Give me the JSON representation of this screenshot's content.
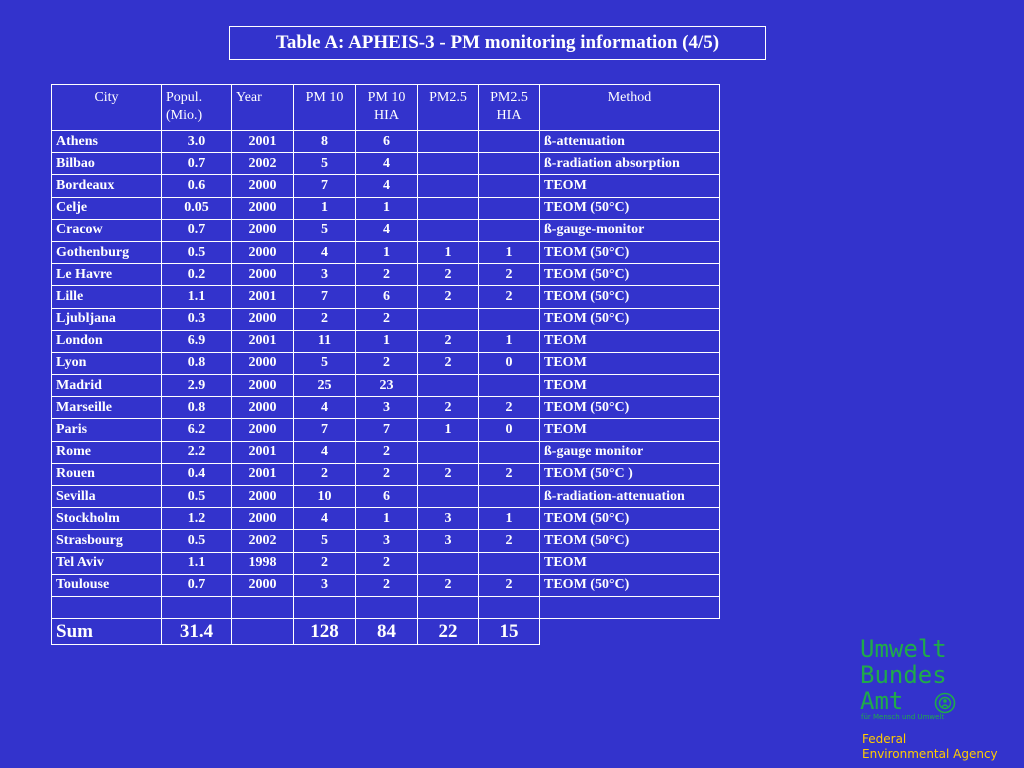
{
  "title": "Table A: APHEIS-3 - PM monitoring information  (4/5)",
  "headers": [
    "City",
    "Popul. (Mio.)",
    "Year",
    "PM 10",
    "PM 10 HIA",
    "PM2.5",
    "PM2.5 HIA",
    "Method"
  ],
  "rows": [
    [
      "Athens",
      "3.0",
      "2001",
      "8",
      "6",
      "",
      "",
      "ß-attenuation"
    ],
    [
      "Bilbao",
      "0.7",
      "2002",
      "5",
      "4",
      "",
      "",
      "ß-radiation absorption"
    ],
    [
      "Bordeaux",
      "0.6",
      "2000",
      "7",
      "4",
      "",
      "",
      "TEOM"
    ],
    [
      "Celje",
      "0.05",
      "2000",
      "1",
      "1",
      "",
      "",
      "TEOM (50°C)"
    ],
    [
      "Cracow",
      "0.7",
      "2000",
      "5",
      "4",
      "",
      "",
      "ß-gauge-monitor"
    ],
    [
      "Gothenburg",
      "0.5",
      "2000",
      "4",
      "1",
      "1",
      "1",
      "TEOM (50°C)"
    ],
    [
      "Le Havre",
      "0.2",
      "2000",
      "3",
      "2",
      "2",
      "2",
      "TEOM (50°C)"
    ],
    [
      "Lille",
      "1.1",
      "2001",
      "7",
      "6",
      "2",
      "2",
      "TEOM (50°C)"
    ],
    [
      "Ljubljana",
      "0.3",
      "2000",
      "2",
      "2",
      "",
      "",
      "TEOM (50°C)"
    ],
    [
      "London",
      "6.9",
      "2001",
      "11",
      "1",
      "2",
      "1",
      "TEOM"
    ],
    [
      "Lyon",
      "0.8",
      "2000",
      "5",
      "2",
      "2",
      "0",
      "TEOM"
    ],
    [
      "Madrid",
      "2.9",
      "2000",
      "25",
      "23",
      "",
      "",
      "TEOM"
    ],
    [
      "Marseille",
      "0.8",
      "2000",
      "4",
      "3",
      "2",
      "2",
      "TEOM (50°C)"
    ],
    [
      "Paris",
      "6.2",
      "2000",
      "7",
      "7",
      "1",
      "0",
      "TEOM"
    ],
    [
      "Rome",
      "2.2",
      "2001",
      "4",
      "2",
      "",
      "",
      "ß-gauge monitor"
    ],
    [
      "Rouen",
      "0.4",
      "2001",
      "2",
      "2",
      "2",
      "2",
      "TEOM (50°C )"
    ],
    [
      "Sevilla",
      "0.5",
      "2000",
      "10",
      "6",
      "",
      "",
      "ß-radiation-attenuation"
    ],
    [
      "Stockholm",
      "1.2",
      "2000",
      "4",
      "1",
      "3",
      "1",
      "TEOM (50°C)"
    ],
    [
      "Strasbourg",
      "0.5",
      "2002",
      "5",
      "3",
      "3",
      "2",
      "TEOM (50°C)"
    ],
    [
      "Tel Aviv",
      "1.1",
      "1998",
      "2",
      "2",
      "",
      "",
      "TEOM"
    ],
    [
      "Toulouse",
      "0.7",
      "2000",
      "3",
      "2",
      "2",
      "2",
      "TEOM (50°C)"
    ],
    [
      "",
      "",
      "",
      "",
      "",
      "",
      "",
      ""
    ]
  ],
  "sum_row": [
    "Sum",
    "31.4",
    "",
    "128",
    "84",
    "22",
    "15"
  ],
  "logo": {
    "line1": "Umwelt",
    "line2": "Bundes",
    "line3": "Amt",
    "tagline": "für Mensch und Umwelt",
    "emblem_icon": "globe-emblem-icon"
  },
  "agency": {
    "line1": "Federal",
    "line2": "Environmental Agency"
  },
  "colors": {
    "background": "#3333cc",
    "text": "#ffffff",
    "logo_green": "#1faa4a",
    "agency_yellow": "#ffcc00"
  }
}
